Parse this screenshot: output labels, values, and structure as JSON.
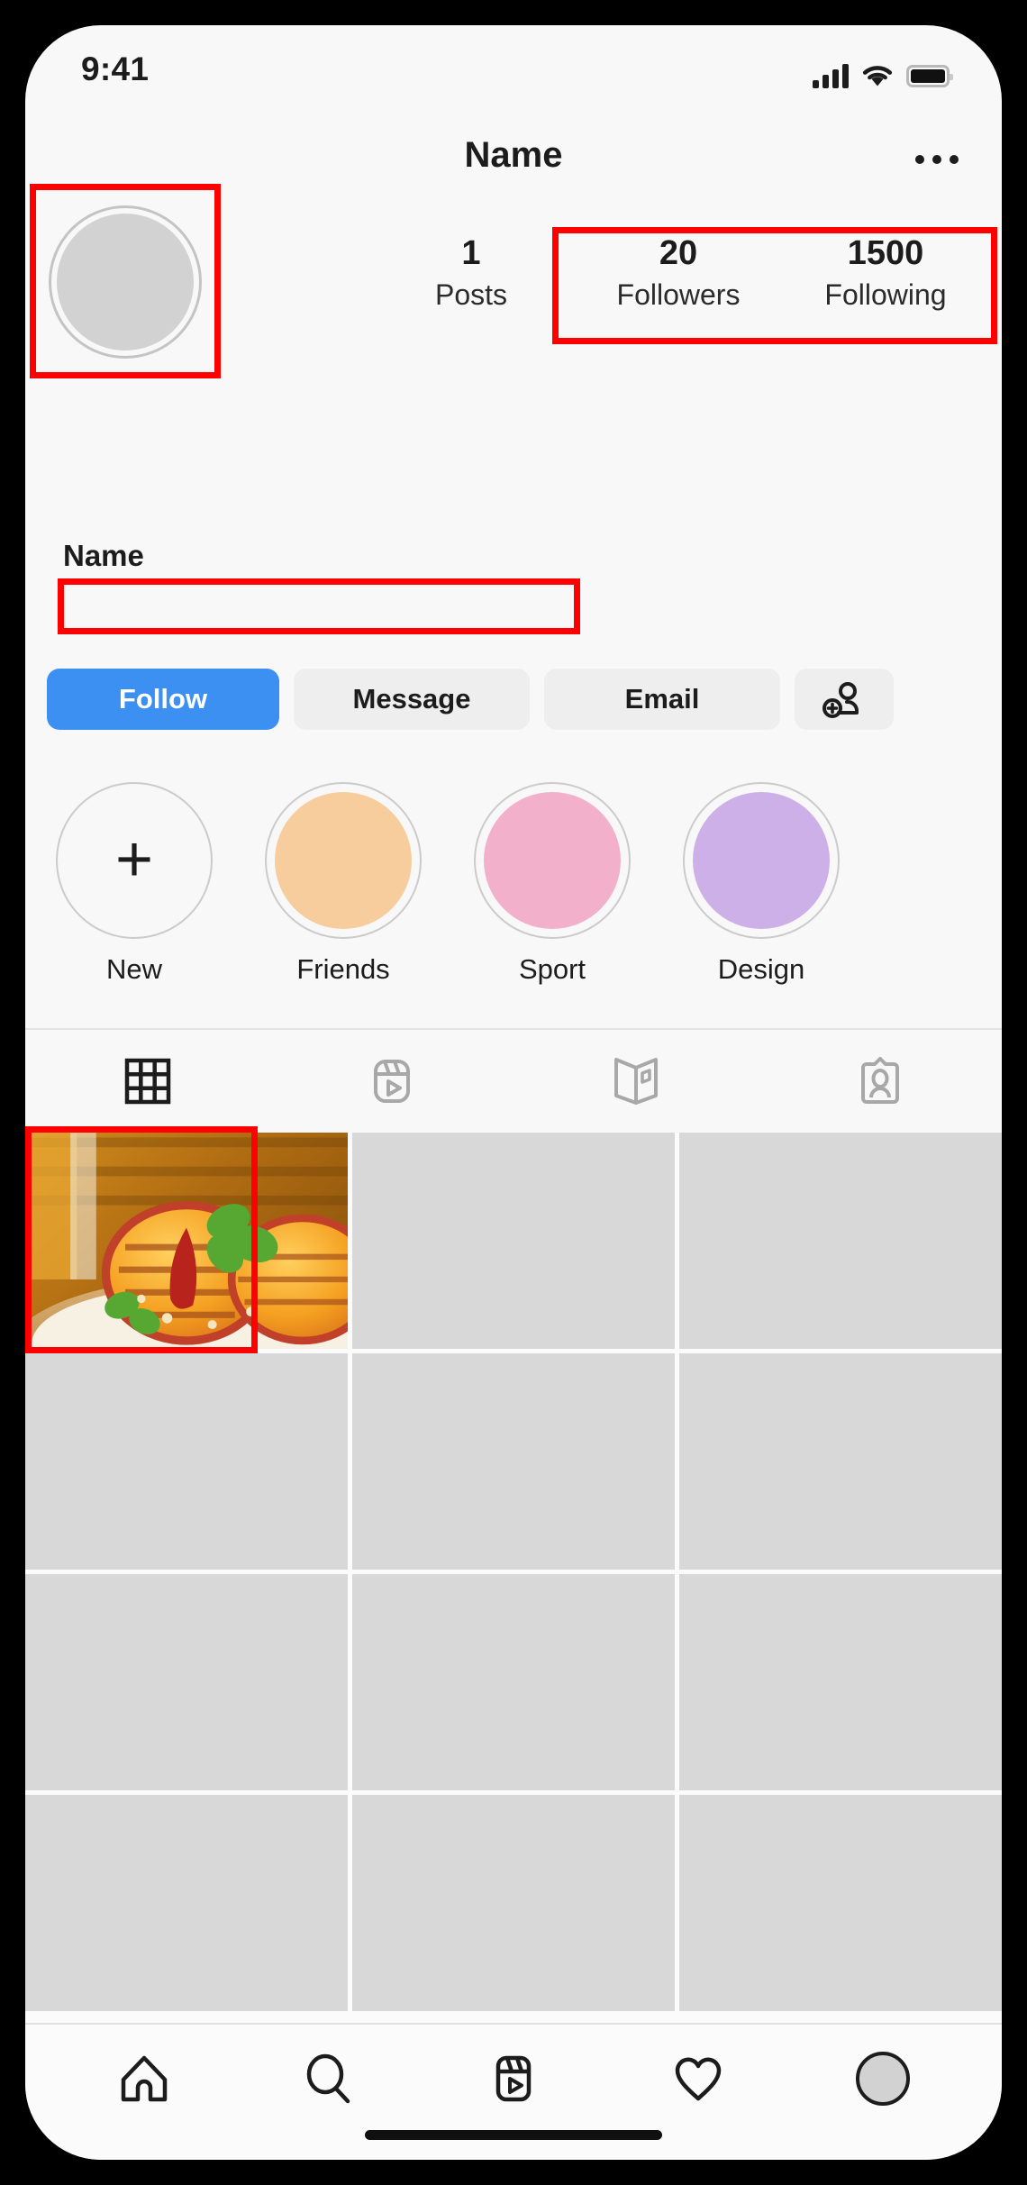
{
  "status_bar": {
    "time": "9:41",
    "signal_icon": "signal-bars-icon",
    "wifi_icon": "wifi-icon",
    "battery_icon": "battery-icon"
  },
  "header": {
    "title": "Name",
    "more_icon": "more-options-icon"
  },
  "profile": {
    "avatar_icon": "avatar-placeholder",
    "stats": [
      {
        "value": "1",
        "label": "Posts"
      },
      {
        "value": "20",
        "label": "Followers"
      },
      {
        "value": "1500",
        "label": "Following"
      }
    ],
    "bio_name": "Name",
    "bio_text": "",
    "bio_placeholder": ""
  },
  "actions": [
    {
      "label": "Follow",
      "style": "primary"
    },
    {
      "label": "Message",
      "style": "secondary"
    },
    {
      "label": "Email",
      "style": "secondary"
    },
    {
      "label": "",
      "style": "icon",
      "icon": "add-person-icon"
    }
  ],
  "highlights": [
    {
      "label": "New",
      "color": "#f8f8f8",
      "icon": "plus-icon"
    },
    {
      "label": "Friends",
      "color": "#f7cd9e",
      "icon": ""
    },
    {
      "label": "Sport",
      "color": "#f2b0ca",
      "icon": ""
    },
    {
      "label": "Design",
      "color": "#cdb0e8",
      "icon": ""
    }
  ],
  "content_tabs": [
    {
      "icon": "grid-icon",
      "active": true
    },
    {
      "icon": "reels-icon",
      "active": false
    },
    {
      "icon": "guides-icon",
      "active": false
    },
    {
      "icon": "tagged-icon",
      "active": false
    }
  ],
  "grid": {
    "first_post_alt": "grilled-peaches-ricotta-toast-photo",
    "empty_cells": 11,
    "empty_cell_color": "#d8d8d8"
  },
  "bottom_nav": [
    {
      "icon": "home-icon",
      "active": true
    },
    {
      "icon": "search-icon",
      "active": false
    },
    {
      "icon": "reels-icon",
      "active": false
    },
    {
      "icon": "heart-icon",
      "active": false
    },
    {
      "icon": "profile-avatar-icon",
      "active": false
    }
  ],
  "annotations": {
    "color": "#ff0000",
    "regions": [
      "avatar",
      "followers-following-stats",
      "bio-input-field",
      "first-grid-photo"
    ]
  },
  "theme": {
    "accent": "#3b90f2",
    "background": "#f8f8f8",
    "text": "#1c1c1c",
    "secondary_button": "#eeeeee"
  }
}
